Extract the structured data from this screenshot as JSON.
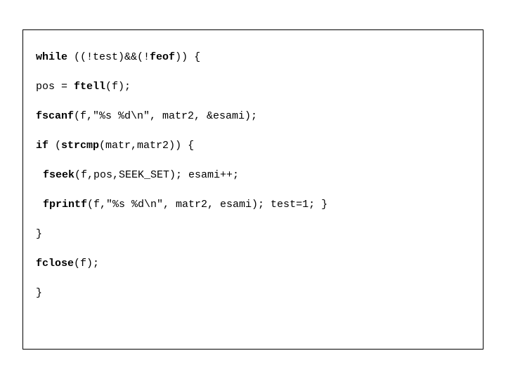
{
  "code": {
    "l1_a": "while",
    "l1_b": " ((!test)&&(!",
    "l1_c": "feof",
    "l1_d": ")) {",
    "l2_a": "pos = ",
    "l2_b": "ftell",
    "l2_c": "(f);",
    "l3_a": "fscanf",
    "l3_b": "(f,\"%s %d\\n\", matr2, &esami);",
    "l4_a": "if",
    "l4_b": " (",
    "l4_c": "strcmp",
    "l4_d": "(matr,matr2)) {",
    "l5_a": "fseek",
    "l5_b": "(f,pos,SEEK_SET); esami++;",
    "l6_a": "fprintf",
    "l6_b": "(f,\"%s %d\\n\", matr2, esami); test=1; }",
    "l7": "}",
    "l8_a": "fclose",
    "l8_b": "(f);",
    "l9": "}"
  }
}
